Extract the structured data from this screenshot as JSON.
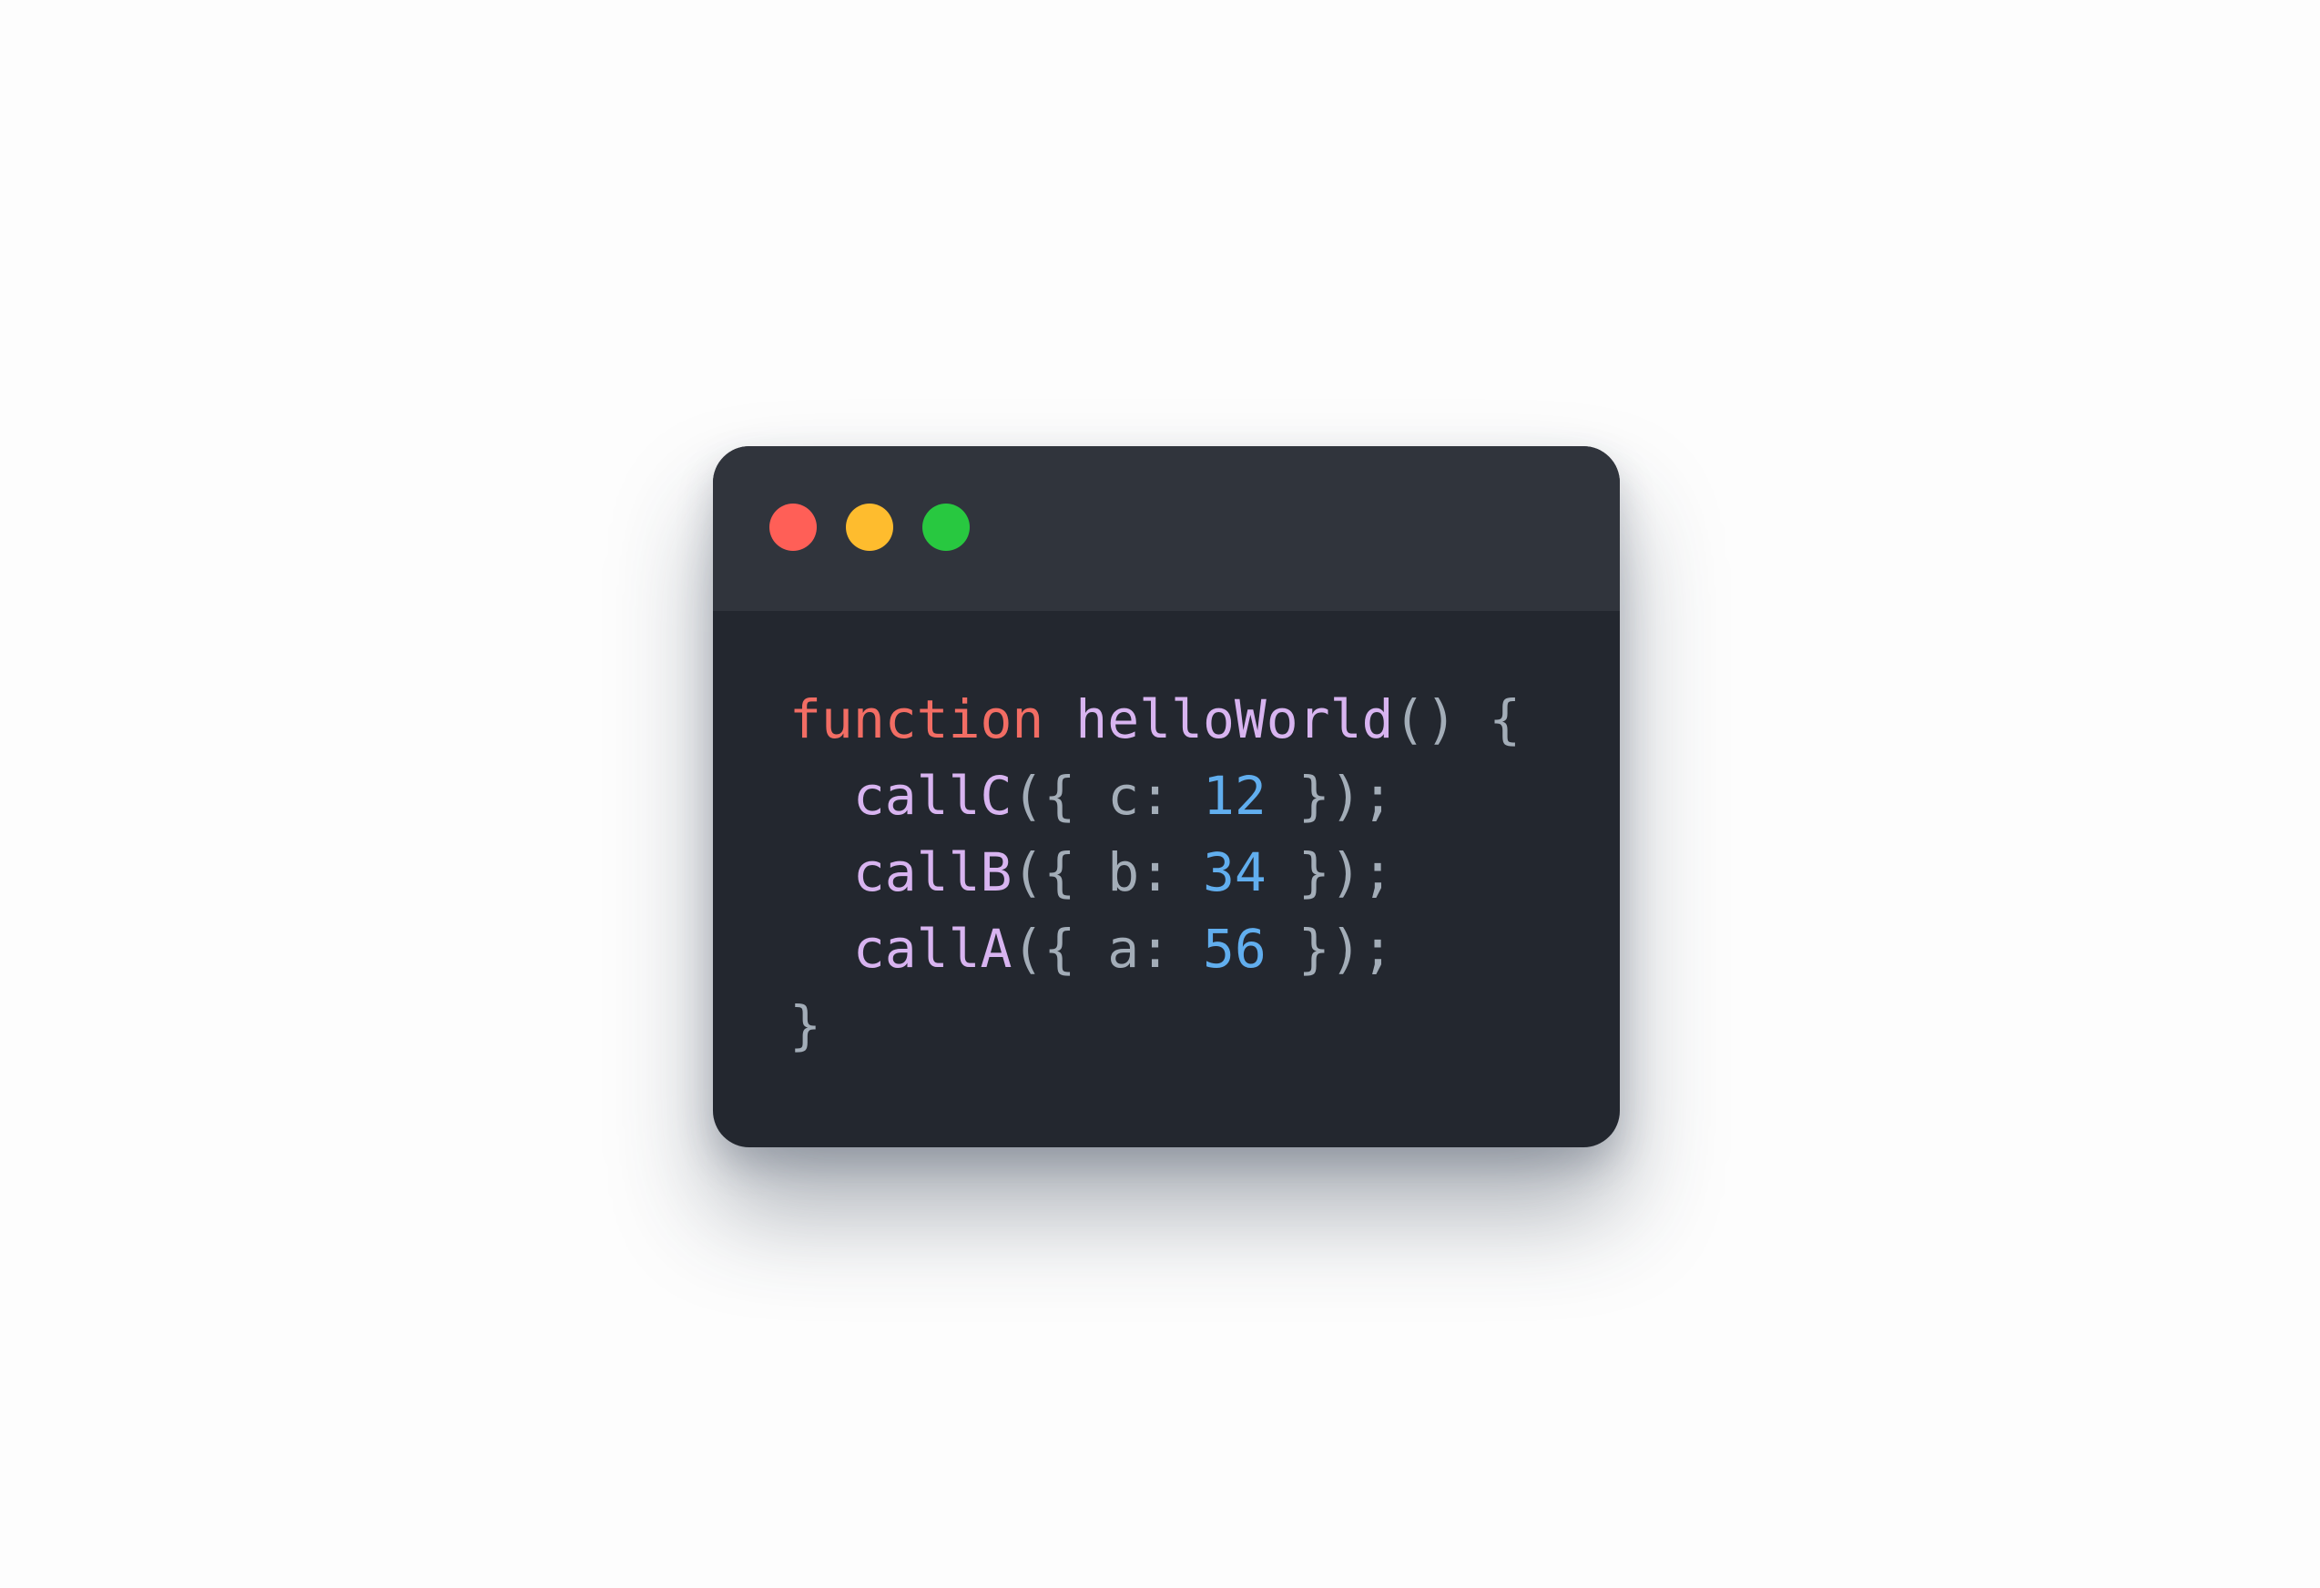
{
  "colors": {
    "page_background": "#fdfdfd",
    "window_background": "#23272f",
    "titlebar_background": "#30343c",
    "close": "#ff5f57",
    "minimize": "#febc2e",
    "maximize": "#28c840",
    "keyword": "#f26d64",
    "function_name": "#d8b4f0",
    "number": "#61aeee",
    "punctuation": "#a3adb8"
  },
  "window_controls": [
    {
      "name": "close",
      "color": "#ff5f57"
    },
    {
      "name": "minimize",
      "color": "#febc2e"
    },
    {
      "name": "maximize",
      "color": "#28c840"
    }
  ],
  "code": {
    "lines": [
      [
        {
          "text": "function",
          "kind": "keyword"
        },
        {
          "text": " ",
          "kind": "punctuation"
        },
        {
          "text": "helloWorld",
          "kind": "function_name"
        },
        {
          "text": "() {",
          "kind": "punctuation"
        }
      ],
      [
        {
          "text": "  ",
          "kind": "punctuation"
        },
        {
          "text": "callC",
          "kind": "function_name"
        },
        {
          "text": "({ c: ",
          "kind": "punctuation"
        },
        {
          "text": "12",
          "kind": "number"
        },
        {
          "text": " });",
          "kind": "punctuation"
        }
      ],
      [
        {
          "text": "  ",
          "kind": "punctuation"
        },
        {
          "text": "callB",
          "kind": "function_name"
        },
        {
          "text": "({ b: ",
          "kind": "punctuation"
        },
        {
          "text": "34",
          "kind": "number"
        },
        {
          "text": " });",
          "kind": "punctuation"
        }
      ],
      [
        {
          "text": "  ",
          "kind": "punctuation"
        },
        {
          "text": "callA",
          "kind": "function_name"
        },
        {
          "text": "({ a: ",
          "kind": "punctuation"
        },
        {
          "text": "56",
          "kind": "number"
        },
        {
          "text": " });",
          "kind": "punctuation"
        }
      ],
      [
        {
          "text": "}",
          "kind": "punctuation"
        }
      ]
    ]
  }
}
